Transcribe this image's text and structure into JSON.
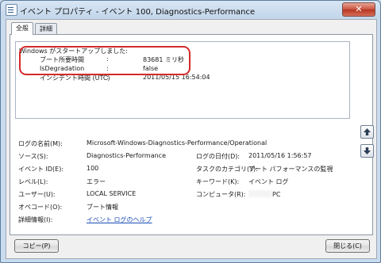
{
  "window": {
    "title": "イベント プロパティ - イベント 100, Diagnostics-Performance",
    "close_glyph": "✕"
  },
  "tabs": [
    {
      "label": "全般",
      "active": true
    },
    {
      "label": "詳細",
      "active": false
    }
  ],
  "description": {
    "heading": "Windows がスタートアップしました:",
    "rows": [
      {
        "key": "ブート所要時間",
        "colon": ":",
        "value": "83681 ミリ秒"
      },
      {
        "key": "IsDegradation",
        "colon": ":",
        "value": "false"
      },
      {
        "key": "インシデント時間 (UTC)",
        "colon": ":",
        "value": "2011/05/15 16:54:04"
      }
    ],
    "highlight_color": "#d42a2a"
  },
  "nav": {
    "up_icon": "arrow-up-icon",
    "down_icon": "arrow-down-icon"
  },
  "properties": {
    "log_name_label": "ログの名前(M):",
    "log_name_value": "Microsoft-Windows-Diagnostics-Performance/Operational",
    "source_label": "ソース(S):",
    "source_value": "Diagnostics-Performance",
    "logged_label": "ログの日付(D):",
    "logged_value": "2011/05/16 1:56:57",
    "event_id_label": "イベント ID(E):",
    "event_id_value": "100",
    "task_label": "タスクのカテゴリ(Y):",
    "task_value": "ブート パフォーマンスの監視",
    "level_label": "レベル(L):",
    "level_value": "エラー",
    "keywords_label": "キーワード(K):",
    "keywords_value": "イベント ログ",
    "user_label": "ユーザー(U):",
    "user_value": "LOCAL SERVICE",
    "computer_label": "コンピュータ(R):",
    "computer_value": "PC",
    "opcode_label": "オペコード(O):",
    "opcode_value": "ブート情報",
    "more_info_label": "詳細情報(I):",
    "more_info_link": "イベント ログのヘルプ"
  },
  "buttons": {
    "copy": "コピー(P)",
    "close": "閉じる(C)"
  }
}
